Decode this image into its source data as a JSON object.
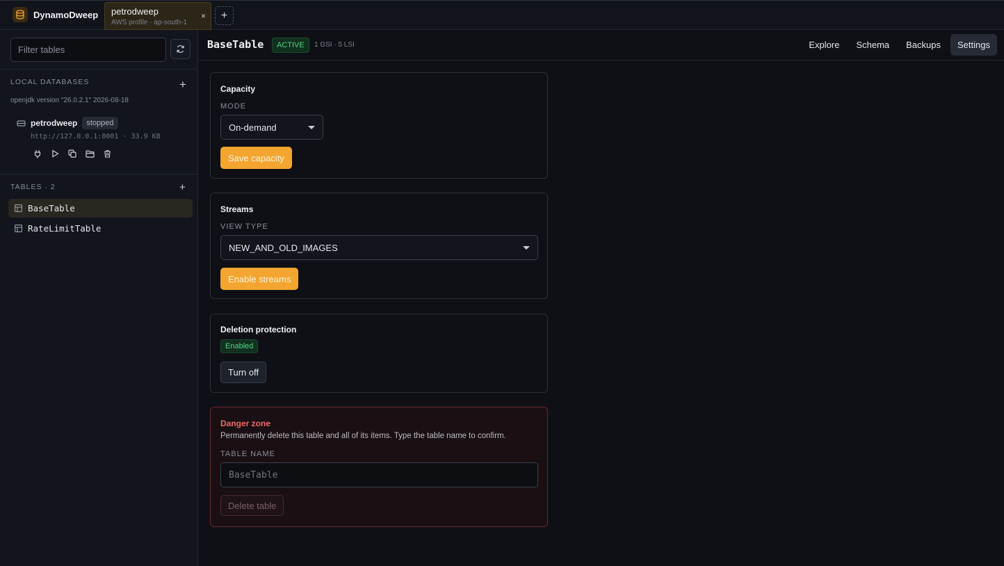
{
  "app": {
    "name": "DynamoDweep"
  },
  "tab": {
    "title": "petrodweep",
    "subtitle": "AWS profile · ap-south-1",
    "close": "×",
    "add": "+"
  },
  "sidebar": {
    "filter_placeholder": "Filter tables",
    "local_databases_label": "LOCAL DATABASES",
    "java_info": "openjdk version \"26.0.2.1\" 2026-08-18",
    "database": {
      "name": "petrodweep",
      "status": "stopped",
      "url": "http://127.0.0.1:8001 · 33.9 KB"
    },
    "tables_label": "TABLES · 2",
    "tables": [
      {
        "name": "BaseTable"
      },
      {
        "name": "RateLimitTable"
      }
    ]
  },
  "header": {
    "table_name": "BaseTable",
    "status": "ACTIVE",
    "index_info": "1 GSI · 5 LSI",
    "nav": [
      "Explore",
      "Schema",
      "Backups",
      "Settings"
    ],
    "active_nav": "Settings"
  },
  "capacity": {
    "title": "Capacity",
    "mode_label": "MODE",
    "mode_value": "On-demand",
    "save_label": "Save capacity"
  },
  "streams": {
    "title": "Streams",
    "view_type_label": "VIEW TYPE",
    "view_type_value": "NEW_AND_OLD_IMAGES",
    "enable_label": "Enable streams"
  },
  "deletion_protection": {
    "title": "Deletion protection",
    "status": "Enabled",
    "toggle_label": "Turn off"
  },
  "danger_zone": {
    "title": "Danger zone",
    "description": "Permanently delete this table and all of its items. Type the table name to confirm.",
    "field_label": "TABLE NAME",
    "placeholder": "BaseTable",
    "delete_label": "Delete table"
  },
  "colors": {
    "accent": "#f3a530",
    "active_green": "#4fd37f",
    "danger_red": "#f06a6a"
  }
}
